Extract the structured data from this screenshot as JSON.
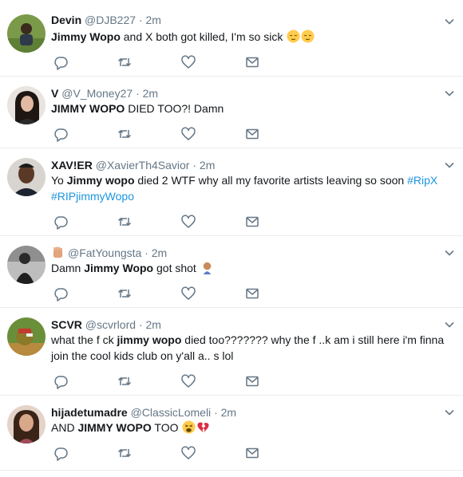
{
  "colors": {
    "text": "#14171a",
    "secondary": "#657786",
    "hashtag": "#1b95e0",
    "divider": "#e6ecf0"
  },
  "icons": {
    "reply": "reply-icon",
    "retweet": "retweet-icon",
    "like": "heart-icon",
    "message": "envelope-icon",
    "more": "chevron-down-icon"
  },
  "tweets": [
    {
      "name": "Devin",
      "handle": "@DJB227",
      "time": "2m",
      "segments": [
        {
          "text": "Jimmy Wopo",
          "bold": true
        },
        {
          "text": " and X both got killed, I'm so sick "
        }
      ],
      "emojis": [
        "relieved-face-emoji",
        "relieved-face-emoji"
      ]
    },
    {
      "name": "V",
      "handle": "@V_Money27",
      "time": "2m",
      "segments": [
        {
          "text": "JIMMY WOPO",
          "bold": true
        },
        {
          "text": " DIED TOO?! Damn"
        }
      ],
      "emojis": []
    },
    {
      "name": "XAV!ER",
      "handle": "@XavierTh4Savior",
      "time": "2m",
      "segments": [
        {
          "text": "Yo "
        },
        {
          "text": "Jimmy wopo",
          "bold": true
        },
        {
          "text": " died 2 WTF why all my favorite artists leaving so soon "
        },
        {
          "text": "#RipX",
          "hashtag": true
        },
        {
          "text": " "
        },
        {
          "text": "#RIPjimmyWopo",
          "hashtag": true
        }
      ],
      "emojis": []
    },
    {
      "name": "",
      "handle": "@FatYoungsta",
      "time": "2m",
      "name_emoji": "raised-fist-emoji",
      "segments": [
        {
          "text": "Damn "
        },
        {
          "text": "Jimmy Wopo",
          "bold": true
        },
        {
          "text": " got shot "
        }
      ],
      "emojis": [
        "person-facepalming-emoji"
      ]
    },
    {
      "name": "SCVR",
      "handle": "@scvrlord",
      "time": "2m",
      "segments": [
        {
          "text": "what the f ck "
        },
        {
          "text": "jimmy wopo",
          "bold": true
        },
        {
          "text": " died too??????? why the f ..k am i still here i'm finna join the cool kids club on y'all a.. s lol"
        }
      ],
      "emojis": []
    },
    {
      "name": "hijadetumadre",
      "handle": "@ClassicLomeli",
      "time": "2m",
      "segments": [
        {
          "text": "AND "
        },
        {
          "text": "JIMMY WOPO",
          "bold": true
        },
        {
          "text": " TOO "
        }
      ],
      "emojis": [
        "weary-face-emoji",
        "broken-heart-emoji"
      ]
    }
  ]
}
